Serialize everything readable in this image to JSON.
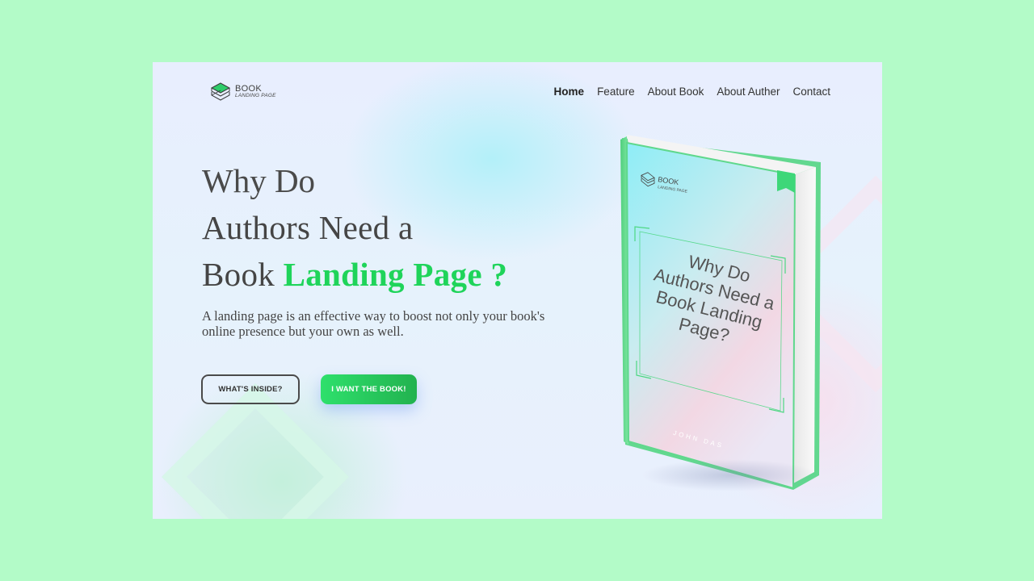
{
  "brand": {
    "title": "BOOK",
    "subtitle": "LANDING PAGE"
  },
  "nav": {
    "items": [
      {
        "label": "Home",
        "active": true
      },
      {
        "label": "Feature",
        "active": false
      },
      {
        "label": "About Book",
        "active": false
      },
      {
        "label": "About Auther",
        "active": false
      },
      {
        "label": "Contact",
        "active": false
      }
    ]
  },
  "hero": {
    "line1": "Why Do",
    "line2": "Authors Need a",
    "line3_prefix": "Book ",
    "line3_accent": "Landing Page",
    "line3_suffix": " ?",
    "description": "A landing page is an effective way to boost not only your book's online presence but your own as well."
  },
  "buttons": {
    "secondary_label": "WHAT'S INSIDE?",
    "primary_label": "I WANT THE BOOK!"
  },
  "book_cover": {
    "brand_title": "BOOK",
    "brand_subtitle": "LANDING PAGE",
    "title_lines": [
      "Why Do",
      "Authors Need a",
      "Book Landing",
      "Page?"
    ],
    "author": "JOHN DAS"
  },
  "colors": {
    "page_bg": "#b3fbc8",
    "accent": "#1fd45a",
    "text": "#444444",
    "book_edge": "#5ed98a"
  }
}
